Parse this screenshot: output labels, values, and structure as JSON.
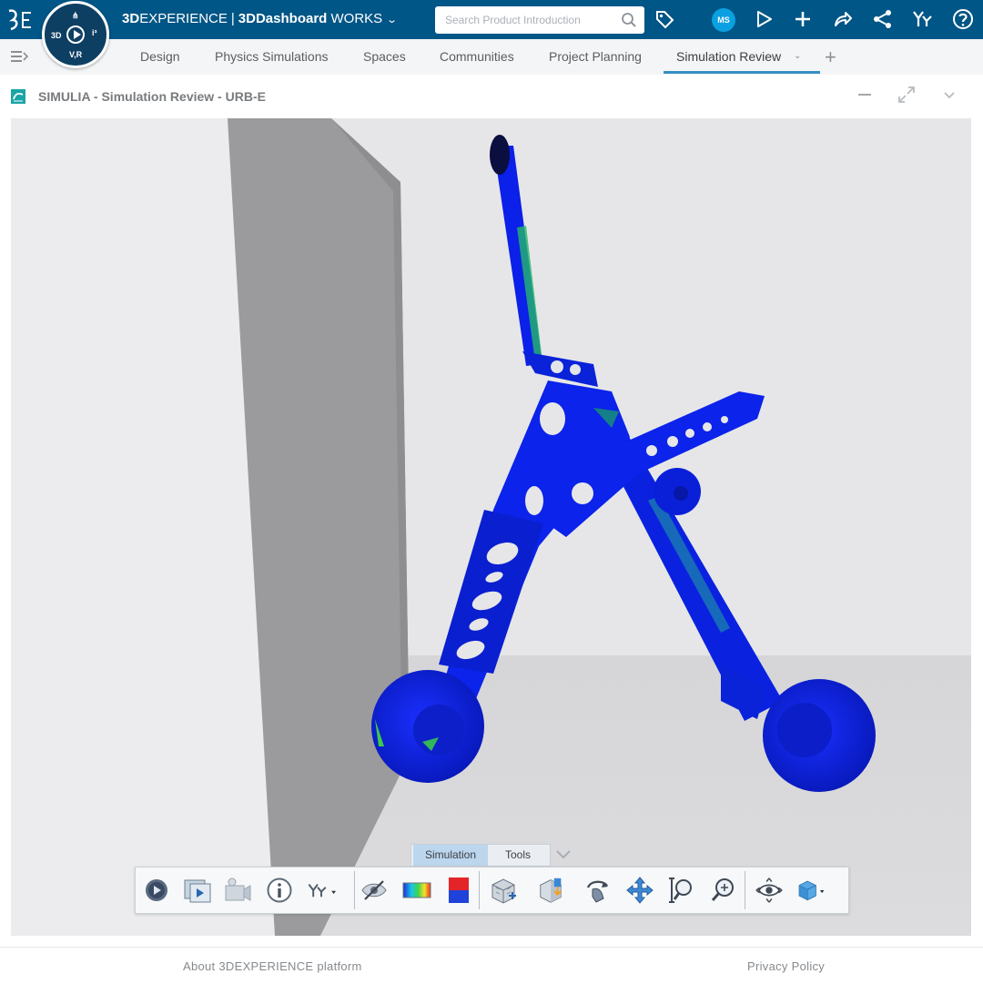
{
  "app": {
    "brand_bold": "3D",
    "brand_rest": "EXPERIENCE",
    "separator": "|",
    "dashboard_bold": "3DDashboard",
    "tenant": "WORKS",
    "compass_labels": [
      "3D",
      "V,R",
      "i³"
    ]
  },
  "search": {
    "placeholder": "Search Product Introduction"
  },
  "user": {
    "initials": "MS"
  },
  "top_icons": [
    "tag-icon",
    "user-avatar",
    "chat-icon",
    "add-icon",
    "share-icon",
    "network-share-icon",
    "apps-icon",
    "help-icon"
  ],
  "tabs": [
    {
      "label": "Design",
      "active": false
    },
    {
      "label": "Physics Simulations",
      "active": false
    },
    {
      "label": "Spaces",
      "active": false
    },
    {
      "label": "Communities",
      "active": false
    },
    {
      "label": "Project Planning",
      "active": false
    },
    {
      "label": "Simulation Review",
      "active": true
    }
  ],
  "widget": {
    "title": "SIMULIA - Simulation Review - URB-E"
  },
  "toolbar": {
    "section_tabs": [
      "Simulation",
      "Tools"
    ],
    "active_section": "Simulation",
    "tools": [
      "play-animation-icon",
      "animation-frames-icon",
      "capture-video-icon",
      "info-icon",
      "apps-menu-icon",
      "hide-show-icon",
      "color-legend-icon",
      "plot-display-icon",
      "deformed-shape-icon",
      "section-view-icon",
      "rotate-icon",
      "pan-icon",
      "zoom-icon",
      "fit-all-icon",
      "view-mode-icon",
      "cube-view-icon"
    ]
  },
  "footer": {
    "about": "About 3DEXPERIENCE platform",
    "privacy": "Privacy Policy"
  },
  "colors": {
    "top_bar": "#005686",
    "accent": "#368ec4",
    "avatar": "#0aa0e2",
    "model_blue": "#0a21e6"
  }
}
